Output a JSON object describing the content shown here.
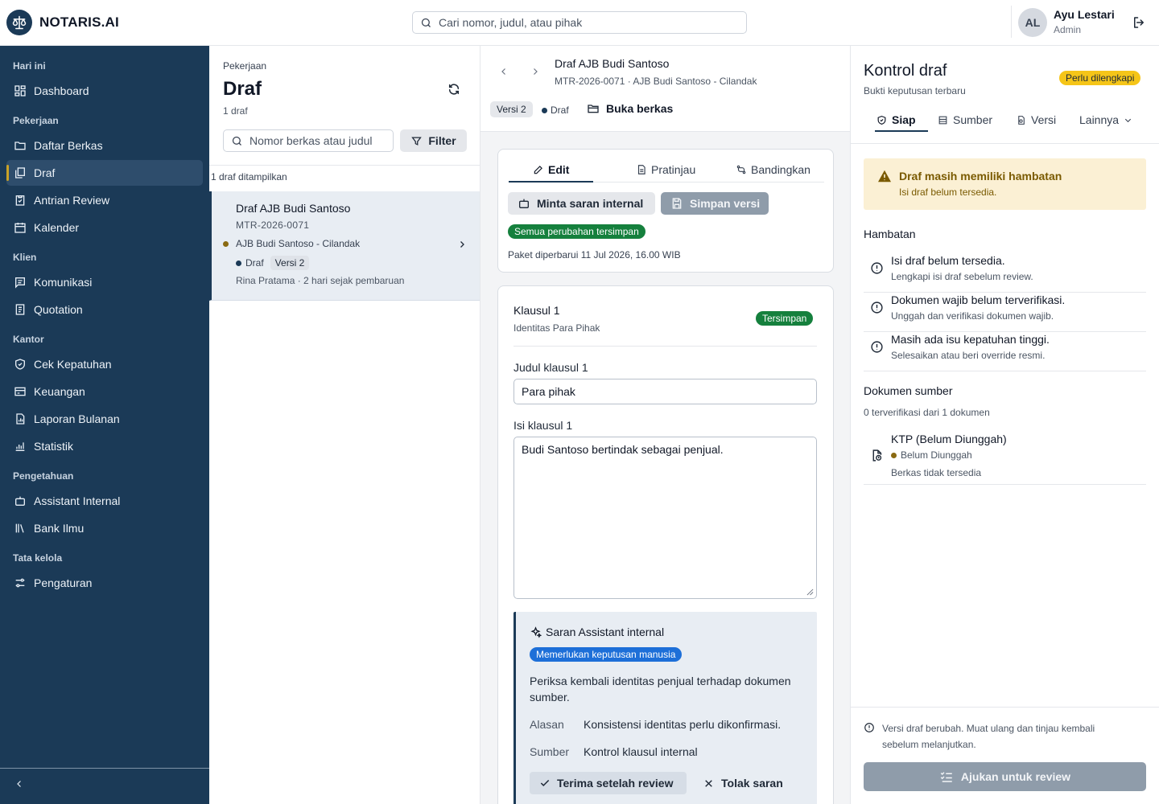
{
  "app": {
    "name": "NOTARIS.AI"
  },
  "search": {
    "placeholder": "Cari nomor, judul, atau pihak"
  },
  "user": {
    "initials": "AL",
    "name": "Ayu Lestari",
    "role": "Admin"
  },
  "sidebar": {
    "sections": [
      "Hari ini",
      "Pekerjaan",
      "Klien",
      "Kantor",
      "Pengetahuan",
      "Tata kelola"
    ],
    "items": [
      {
        "label": "Dashboard",
        "icon": "dashboard-icon"
      },
      {
        "label": "Daftar Berkas",
        "icon": "folder-icon"
      },
      {
        "label": "Draf",
        "icon": "drafts-icon",
        "active": true
      },
      {
        "label": "Antrian Review",
        "icon": "clipboard-icon"
      },
      {
        "label": "Kalender",
        "icon": "calendar-icon"
      },
      {
        "label": "Komunikasi",
        "icon": "message-icon"
      },
      {
        "label": "Quotation",
        "icon": "receipt-icon"
      },
      {
        "label": "Cek Kepatuhan",
        "icon": "shield-check-icon"
      },
      {
        "label": "Keuangan",
        "icon": "wallet-icon"
      },
      {
        "label": "Laporan Bulanan",
        "icon": "report-icon"
      },
      {
        "label": "Statistik",
        "icon": "chart-icon"
      },
      {
        "label": "Assistant Internal",
        "icon": "bot-icon"
      },
      {
        "label": "Bank Ilmu",
        "icon": "library-icon"
      },
      {
        "label": "Pengaturan",
        "icon": "settings-icon"
      }
    ]
  },
  "list": {
    "breadcrumb": "Pekerjaan",
    "title": "Draf",
    "count": "1 draf",
    "search_placeholder": "Nomor berkas atau judul",
    "filter_label": "Filter",
    "shown_text": "1 draf ditampilkan",
    "card": {
      "title": "Draf AJB Budi Santoso",
      "code": "MTR-2026-0071",
      "client": "AJB Budi Santoso - Cilandak",
      "status": "Draf",
      "version": "Versi 2",
      "meta": "Rina Pratama · 2 hari sejak pembaruan"
    }
  },
  "editor": {
    "title": "Draf AJB Budi Santoso",
    "subtitle": "MTR-2026-0071 · AJB Budi Santoso - Cilandak",
    "version": "Versi 2",
    "state": "Draf",
    "open_label": "Buka berkas",
    "tabs": [
      "Edit",
      "Pratinjau",
      "Bandingkan"
    ],
    "ask_label": "Minta saran internal",
    "save_label": "Simpan versi",
    "saved_badge": "Semua perubahan tersimpan",
    "package_note": "Paket diperbarui 11 Jul 2026, 16.00 WIB",
    "clause": {
      "title": "Klausul 1",
      "subtitle": "Identitas Para Pihak",
      "badge": "Tersimpan",
      "title_label": "Judul klausul 1",
      "title_value": "Para pihak",
      "body_label": "Isi klausul 1",
      "body_value": "Budi Santoso bertindak sebagai penjual."
    },
    "suggestion": {
      "title": "Saran Assistant internal",
      "badge": "Memerlukan keputusan manusia",
      "text": "Periksa kembali identitas penjual terhadap dokumen sumber.",
      "reason_key": "Alasan",
      "reason_value": "Konsistensi identitas perlu dikonfirmasi.",
      "source_key": "Sumber",
      "source_value": "Kontrol klausul internal",
      "accept_label": "Terima setelah review",
      "reject_label": "Tolak saran"
    }
  },
  "control": {
    "title": "Kontrol draf",
    "subtitle": "Bukti keputusan terbaru",
    "badge": "Perlu dilengkapi",
    "tabs": [
      "Siap",
      "Sumber",
      "Versi",
      "Lainnya"
    ],
    "warning_title": "Draf masih memiliki hambatan",
    "warning_text": "Isi draf belum tersedia.",
    "blockers_title": "Hambatan",
    "blockers": [
      {
        "title": "Isi draf belum tersedia.",
        "sub": "Lengkapi isi draf sebelum review."
      },
      {
        "title": "Dokumen wajib belum terverifikasi.",
        "sub": "Unggah dan verifikasi dokumen wajib."
      },
      {
        "title": "Masih ada isu kepatuhan tinggi.",
        "sub": "Selesaikan atau beri override resmi."
      }
    ],
    "docs_title": "Dokumen sumber",
    "docs_count": "0 terverifikasi dari 1 dokumen",
    "doc": {
      "title": "KTP (Belum Diunggah)",
      "status": "Belum Diunggah",
      "sub": "Berkas tidak tersedia"
    },
    "footer_note": "Versi draf berubah. Muat ulang dan tinjau kembali sebelum melanjutkan.",
    "submit_label": "Ajukan untuk review"
  },
  "colors": {
    "sidebar": "#1b3a57",
    "accent_gold": "#c9a227",
    "success": "#15803d",
    "info": "#1d6fd8",
    "warning": "#f5c518"
  }
}
